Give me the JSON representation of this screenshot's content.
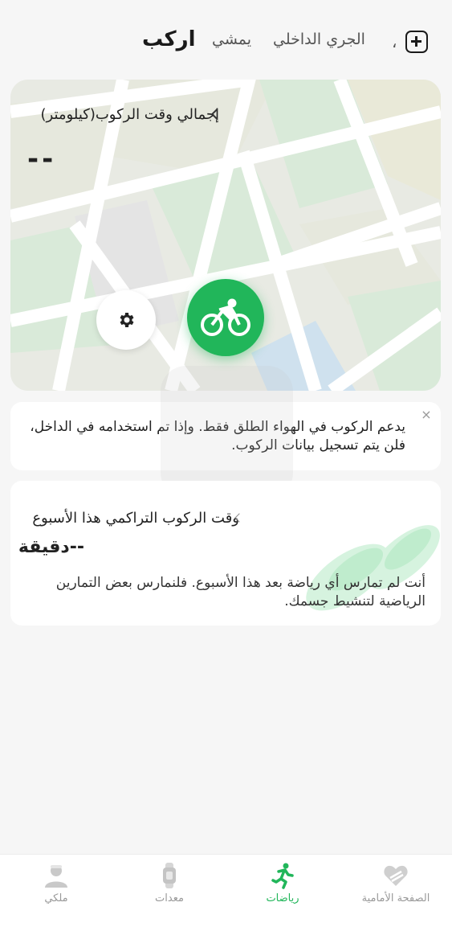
{
  "tabs": {
    "ride": "اركب",
    "walk": "يمشي",
    "indoor_run": "الجري الداخلي",
    "more": "،"
  },
  "map_card": {
    "stat_label": "إجمالي وقت الركوب(كيلومتر)",
    "stat_value": "--"
  },
  "notice": {
    "text": "يدعم الركوب في الهواء الطلق فقط. وإذا تم استخدامه في الداخل، فلن يتم تسجيل بيانات الركوب.",
    "close": "×"
  },
  "weekly": {
    "title": "وقت الركوب التراكمي هذا الأسبوع",
    "value": "--دقيقة",
    "message": "أنت لم تمارس أي رياضة بعد هذا الأسبوع. فلنمارس بعض التمارين الرياضية لتنشيط جسمك."
  },
  "bottom_nav": {
    "home": "الصفحة الأمامية",
    "sports": "رياضات",
    "devices": "معدات",
    "profile": "ملكي"
  },
  "colors": {
    "accent": "#21b65a",
    "background": "#f6f6f6"
  },
  "icons": [
    "add-icon",
    "chevron-left-icon",
    "gear-icon",
    "cycling-icon",
    "close-icon",
    "home-icon",
    "running-icon",
    "watch-icon",
    "profile-icon"
  ]
}
